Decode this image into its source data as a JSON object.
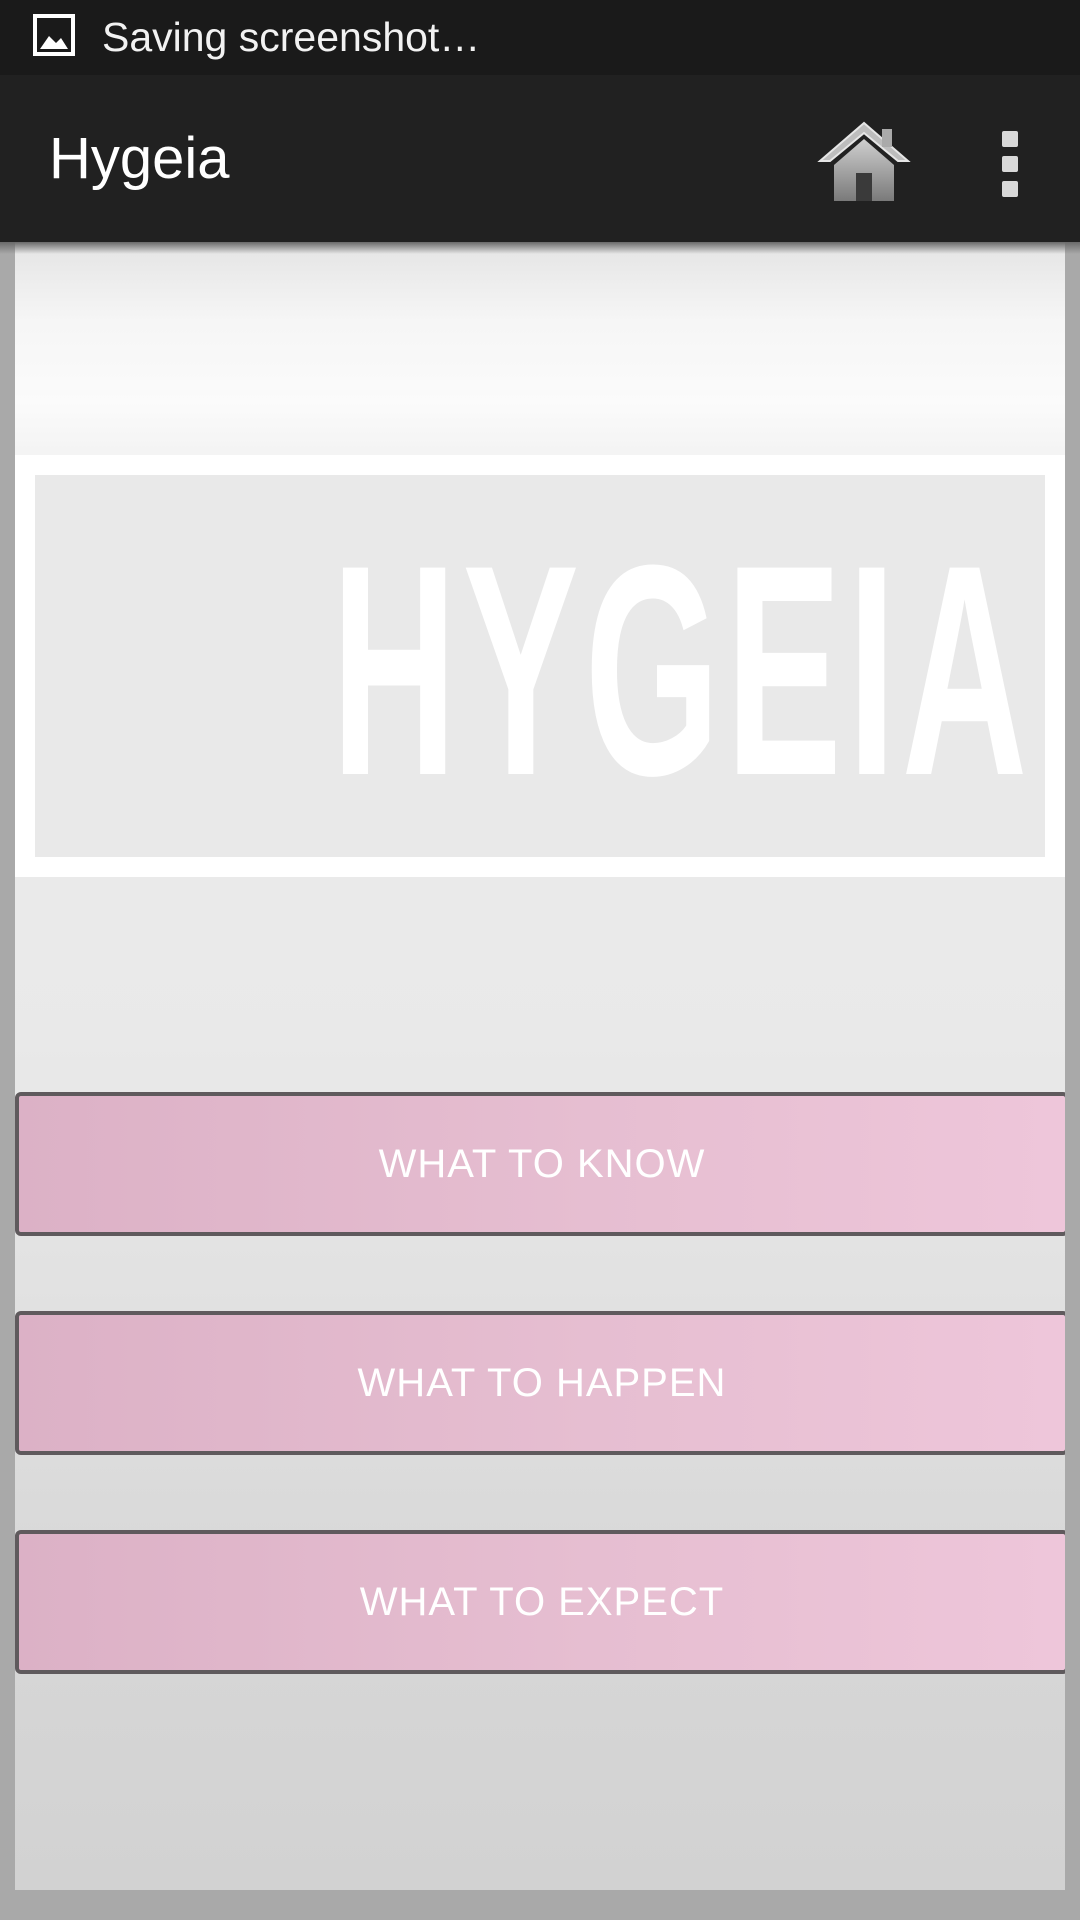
{
  "status_bar": {
    "notification_icon": "picture-icon",
    "text": "Saving screenshot…"
  },
  "action_bar": {
    "title": "Hygeia",
    "home_icon": "home-icon",
    "overflow_icon": "overflow-menu-icon"
  },
  "logo": {
    "text": "HYGEIA"
  },
  "menu": {
    "buttons": [
      {
        "label": "WHAT TO KNOW"
      },
      {
        "label": "WHAT TO HAPPEN"
      },
      {
        "label": "WHAT TO EXPECT"
      }
    ]
  },
  "colors": {
    "status_bar": "#1a1a1a",
    "action_bar": "#212121",
    "button_fill": "#e6bed1",
    "button_border": "#5f5a5d",
    "page_background": "#a9a9a9"
  }
}
